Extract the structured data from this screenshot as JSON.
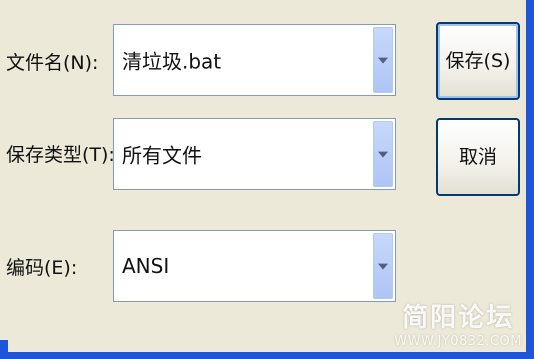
{
  "dialog": {
    "filename_label": "文件名(N):",
    "filename_value": "清垃圾.bat",
    "filetype_label": "保存类型(T):",
    "filetype_value": "所有文件",
    "encoding_label": "编码(E):",
    "encoding_value": "ANSI"
  },
  "buttons": {
    "save_label": "保存(S)",
    "cancel_label": "取消"
  },
  "watermark": {
    "name": "简阳论坛",
    "url": "WWW.JY0832.COM"
  },
  "icons": {
    "dropdown_arrow": "chevron-down-icon"
  },
  "colors": {
    "dialog_bg": "#ece9d8",
    "frame_blue": "#1f55d8",
    "button_border": "#003c74"
  }
}
